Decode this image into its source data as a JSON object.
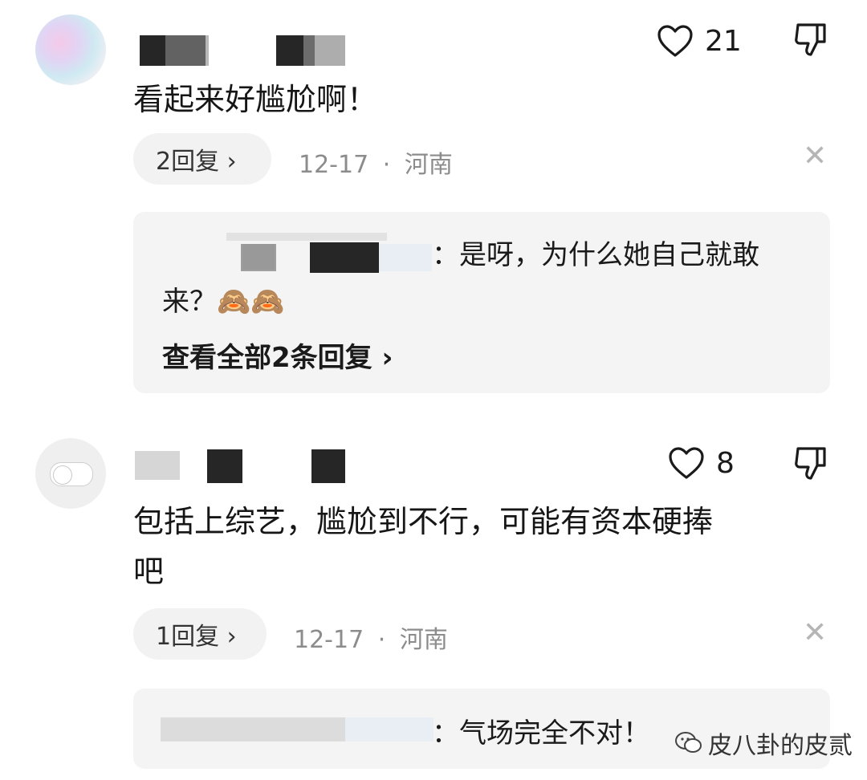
{
  "comments": [
    {
      "text": "看起来好尴尬啊！",
      "likes": "21",
      "reply_button": "2回复 ›",
      "date": "12-17",
      "separator": "·",
      "location": "河南",
      "reply_preview": {
        "line1": "：是呀，为什么她自己就敢",
        "line2": "来？🙈🙈",
        "view_all": "查看全部2条回复 ›"
      }
    },
    {
      "text_line1": "包括上综艺，尴尬到不行，可能有资本硬捧",
      "text_line2": "吧",
      "likes": "8",
      "reply_button": "1回复 ›",
      "date": "12-17",
      "separator": "·",
      "location": "河南",
      "reply_preview": {
        "line1": "：气场完全不对！"
      }
    }
  ],
  "watermark": "皮八卦的皮贰",
  "icons": [
    "heart-icon",
    "dislike-icon",
    "close-icon",
    "wechat-icon"
  ],
  "colors": {
    "meta": "#8c8c8c",
    "pill_bg": "#f2f2f2",
    "reply_bg": "#f4f4f4"
  }
}
